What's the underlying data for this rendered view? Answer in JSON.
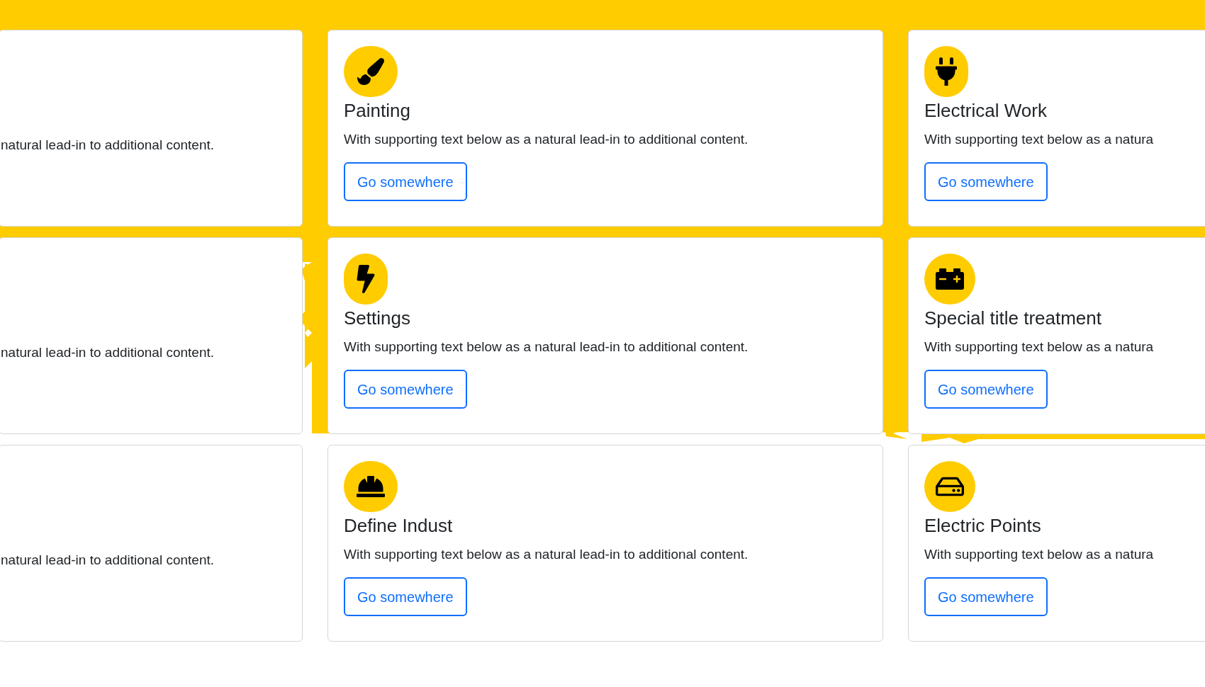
{
  "rows": [
    {
      "cards": [
        {
          "kind": "partial",
          "description": "natural lead-in to additional content."
        },
        {
          "kind": "full",
          "title": "Painting",
          "description": "With supporting text below as a natural lead-in to additional content.",
          "button": "Go somewhere"
        },
        {
          "kind": "full",
          "title": "Electrical Work",
          "description": "With supporting text below as a natura",
          "button": "Go somewhere"
        }
      ]
    },
    {
      "cards": [
        {
          "kind": "partial",
          "description": "natural lead-in to additional content."
        },
        {
          "kind": "full",
          "title": "Settings",
          "description": "With supporting text below as a natural lead-in to additional content.",
          "button": "Go somewhere"
        },
        {
          "kind": "full",
          "title": "Special title treatment",
          "description": "With supporting text below as a natura",
          "button": "Go somewhere"
        }
      ]
    },
    {
      "cards": [
        {
          "kind": "partial",
          "description": "natural lead-in to additional content."
        },
        {
          "kind": "full",
          "title": "Define Indust",
          "description": "With supporting text below as a natural lead-in to additional content.",
          "button": "Go somewhere"
        },
        {
          "kind": "full",
          "title": "Electric Points",
          "description": "With supporting text below as a natura",
          "button": "Go somewhere"
        }
      ]
    }
  ]
}
